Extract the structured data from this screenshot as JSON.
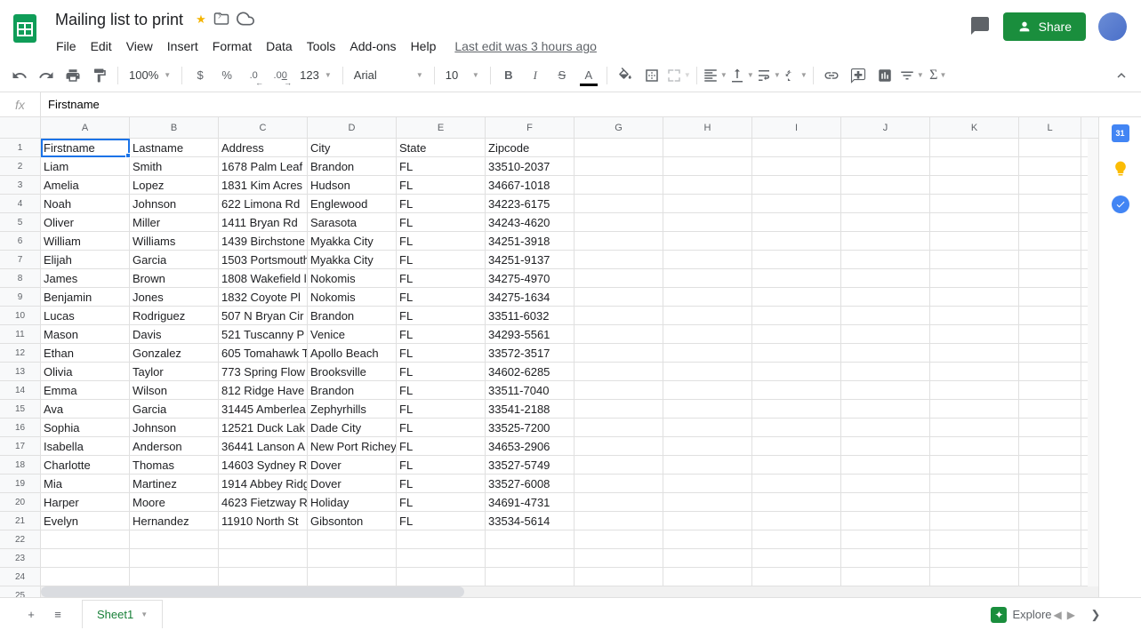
{
  "doc": {
    "title": "Mailing list to print"
  },
  "menu": {
    "file": "File",
    "edit": "Edit",
    "view": "View",
    "insert": "Insert",
    "format": "Format",
    "data": "Data",
    "tools": "Tools",
    "addons": "Add-ons",
    "help": "Help",
    "last_edit": "Last edit was 3 hours ago"
  },
  "share": {
    "label": "Share"
  },
  "toolbar": {
    "zoom": "100%",
    "currency": "$",
    "percent": "%",
    "dec_dec": ".0",
    "inc_dec": ".00",
    "num_format": "123",
    "font": "Arial",
    "font_size": "10"
  },
  "formula_bar": {
    "value": "Firstname"
  },
  "columns": [
    "A",
    "B",
    "C",
    "D",
    "E",
    "F",
    "G",
    "H",
    "I",
    "J",
    "K",
    "L"
  ],
  "headers": [
    "Firstname",
    "Lastname",
    "Address",
    "City",
    "State",
    "Zipcode"
  ],
  "rows": [
    [
      "Liam",
      "Smith",
      "1678 Palm Leaf",
      "Brandon",
      "FL",
      "33510-2037"
    ],
    [
      "Amelia",
      "Lopez",
      "1831 Kim Acres",
      "Hudson",
      "FL",
      "34667-1018"
    ],
    [
      "Noah",
      "Johnson",
      "622 Limona Rd",
      "Englewood",
      "FL",
      "34223-6175"
    ],
    [
      "Oliver",
      "Miller",
      "1411 Bryan Rd",
      "Sarasota",
      "FL",
      "34243-4620"
    ],
    [
      "William",
      "Williams",
      "1439 Birchstone",
      "Myakka City",
      "FL",
      "34251-3918"
    ],
    [
      "Elijah",
      "Garcia",
      "1503 Portsmouth",
      "Myakka City",
      "FL",
      "34251-9137"
    ],
    [
      "James",
      "Brown",
      "1808 Wakefield l",
      "Nokomis",
      "FL",
      "34275-4970"
    ],
    [
      "Benjamin",
      "Jones",
      "1832 Coyote Pl",
      "Nokomis",
      "FL",
      "34275-1634"
    ],
    [
      "Lucas",
      "Rodriguez",
      "507 N Bryan Cir",
      "Brandon",
      "FL",
      "33511-6032"
    ],
    [
      "Mason",
      "Davis",
      "521 Tuscanny P",
      "Venice",
      "FL",
      "34293-5561"
    ],
    [
      "Ethan",
      "Gonzalez",
      "605 Tomahawk T",
      "Apollo Beach",
      "FL",
      "33572-3517"
    ],
    [
      "Olivia",
      "Taylor",
      "773 Spring Flow",
      "Brooksville",
      "FL",
      "34602-6285"
    ],
    [
      "Emma",
      "Wilson",
      "812 Ridge Have",
      "Brandon",
      "FL",
      "33511-7040"
    ],
    [
      "Ava",
      "Garcia",
      "31445 Amberlea",
      "Zephyrhills",
      "FL",
      "33541-2188"
    ],
    [
      "Sophia",
      "Johnson",
      "12521 Duck Lak",
      "Dade City",
      "FL",
      "33525-7200"
    ],
    [
      "Isabella",
      "Anderson",
      "36441 Lanson A",
      "New Port Richey",
      "FL",
      "34653-2906"
    ],
    [
      "Charlotte",
      "Thomas",
      "14603 Sydney R",
      "Dover",
      "FL",
      "33527-5749"
    ],
    [
      "Mia",
      "Martinez",
      "1914 Abbey Ridg",
      "Dover",
      "FL",
      "33527-6008"
    ],
    [
      "Harper",
      "Moore",
      "4623 Fietzway R",
      "Holiday",
      "FL",
      "34691-4731"
    ],
    [
      "Evelyn",
      "Hernandez",
      "11910 North St",
      "Gibsonton",
      "FL",
      "33534-5614"
    ]
  ],
  "extra_rows": 4,
  "sheet": {
    "tab1": "Sheet1",
    "explore": "Explore"
  }
}
